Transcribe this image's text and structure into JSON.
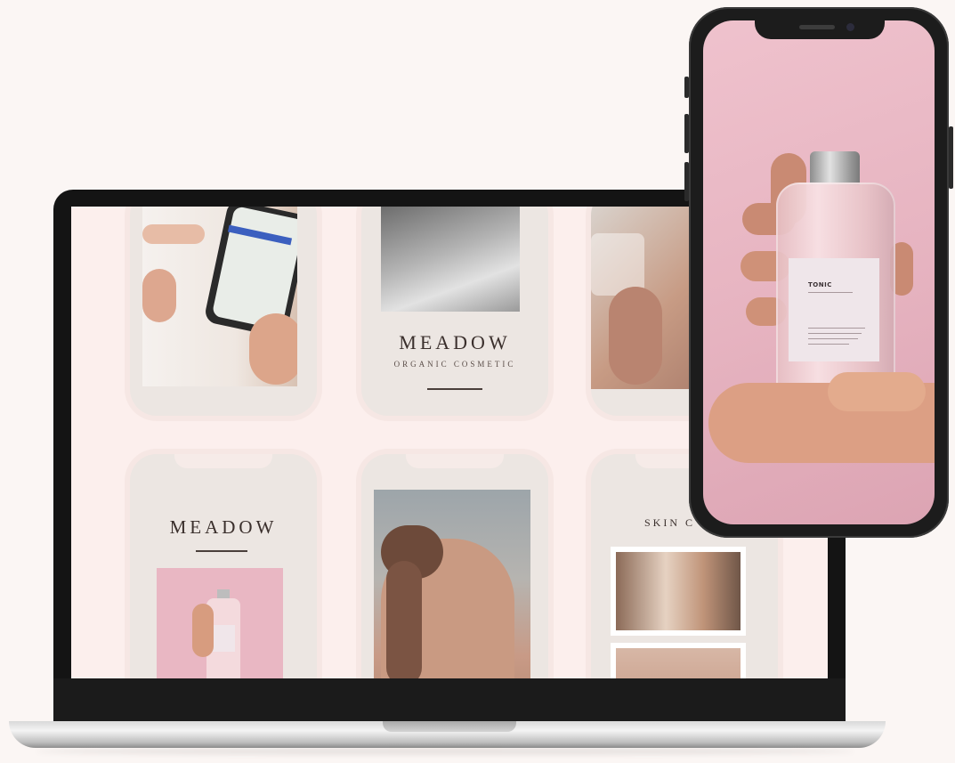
{
  "laptop": {
    "cards": [
      {
        "id": "card-hand-phone"
      },
      {
        "id": "card-meadow-top",
        "brand": "MEADOW",
        "tagline": "ORGANIC COSMETIC"
      },
      {
        "id": "card-drink"
      },
      {
        "id": "card-meadow-bottle",
        "brand": "MEADOW"
      },
      {
        "id": "card-face"
      },
      {
        "id": "card-skin-care",
        "title": "SKIN C"
      }
    ]
  },
  "phone": {
    "label_title": "TONIC"
  },
  "colors": {
    "background": "#fbf6f4",
    "laptop_screen": "#fcefed",
    "card": "#ece6e2",
    "phone_screen": "#e6b3c0"
  },
  "icons": [
    "laptop-device-icon",
    "smartphone-device-icon",
    "bottle-icon"
  ]
}
